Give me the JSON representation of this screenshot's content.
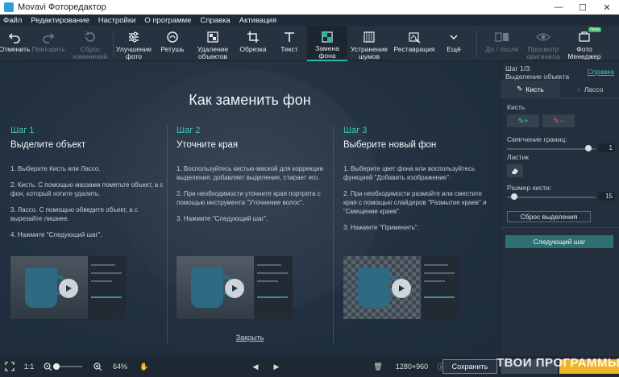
{
  "window": {
    "title": "Movavi Фоторедактор",
    "minimize": "—",
    "maximize": "☐",
    "close": "✕"
  },
  "menu": [
    "Файл",
    "Редактирование",
    "Настройки",
    "О программе",
    "Справка",
    "Активация"
  ],
  "toolbar": {
    "undo": "Отменить",
    "redo": "Повторить",
    "reset": "Сброс изменений",
    "enhance": "Улучшение фото",
    "retouch": "Ретушь",
    "remove_objects": "Удаление объектов",
    "crop": "Обрезка",
    "text": "Текст",
    "replace_bg": "Замена фона",
    "denoise": "Устранение шумов",
    "restore": "Реставрация",
    "more": "Ещё",
    "before_after": "До / после",
    "view_original": "Просмотр оригинала",
    "photo_manager": "Фото Менеджер",
    "new_badge": "New"
  },
  "overlay": {
    "title": "Как заменить фон",
    "close": "Закрыть",
    "steps": [
      {
        "num": "Шаг 1",
        "head": "Выделите объект",
        "texts": [
          "1. Выберите Кисть или Лассо.",
          "2. Кисть. С помощью маззами пометьте объект, а с фон, который хотите удалить.",
          "3. Лассо. С помощью обведите объект, а с вырезайте лишнее.",
          "4. Нажмите \"Следующий шаг\"."
        ]
      },
      {
        "num": "Шаг 2",
        "head": "Уточните края",
        "texts": [
          "1. Воспользуйтесь кистью-маской для коррекции выделения. добавляет выделение, стирает его.",
          "2. При необходимости уточните края портрета с помощью инструмента \"Уточнение волос\".",
          "3. Нажмите \"Следующий шаг\"."
        ]
      },
      {
        "num": "Шаг 3",
        "head": "Выберите новый фон",
        "texts": [
          "1. Выберите цвет фона или воспользуйтесь функцией \"Добавить изображение\".",
          "2. При необходимости размойте или сместите края с помощью слайдеров \"Размытие краев\" и \"Смещение краев\".",
          "3. Нажмите \"Применить\"."
        ]
      }
    ]
  },
  "panel": {
    "step_line1": "Шаг 1/3:",
    "step_line2": "Выделение объекта",
    "help": "Справка",
    "tab_brush": "Кисть",
    "tab_lasso": "Лассо",
    "brush_label": "Кисть",
    "brush_plus": "+",
    "brush_minus": "−",
    "softness_label": "Смягчение границ:",
    "softness_value": "1",
    "softness_level": 0.92,
    "eraser_label": "Ластик",
    "size_label": "Размер кисти:",
    "size_value": "15",
    "size_level": 0.08,
    "reset_selection": "Сброс выделения",
    "next_step": "Следующий шаг"
  },
  "bottom": {
    "fit": "1:1",
    "zoom": "64%",
    "zoom_level": 0.1,
    "resolution": "1280×960",
    "save": "Сохранить",
    "watermark": "ТВОИ ПРОГРАММЫ РУ"
  }
}
